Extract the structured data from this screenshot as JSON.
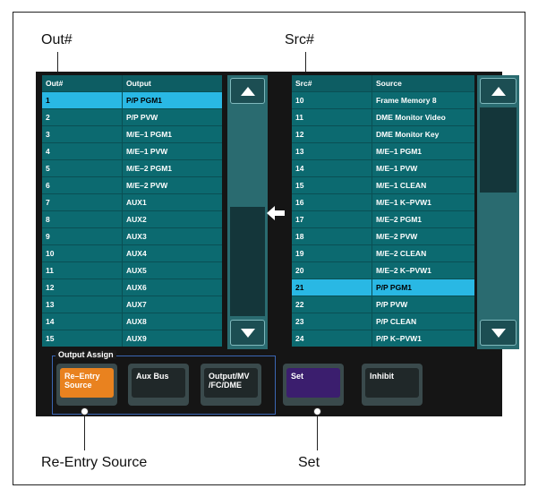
{
  "callouts": {
    "out_num": "Out#",
    "src_num": "Src#",
    "re_entry_source": "Re-Entry Source",
    "set": "Set"
  },
  "output_table": {
    "headers": [
      "Out#",
      "Output"
    ],
    "rows": [
      {
        "num": "1",
        "name": "P/P PGM1",
        "selected": true
      },
      {
        "num": "2",
        "name": "P/P PVW"
      },
      {
        "num": "3",
        "name": "M/E–1 PGM1"
      },
      {
        "num": "4",
        "name": "M/E–1 PVW"
      },
      {
        "num": "5",
        "name": "M/E–2 PGM1"
      },
      {
        "num": "6",
        "name": "M/E–2 PVW"
      },
      {
        "num": "7",
        "name": "AUX1"
      },
      {
        "num": "8",
        "name": "AUX2"
      },
      {
        "num": "9",
        "name": "AUX3"
      },
      {
        "num": "10",
        "name": "AUX4"
      },
      {
        "num": "11",
        "name": "AUX5"
      },
      {
        "num": "12",
        "name": "AUX6"
      },
      {
        "num": "13",
        "name": "AUX7"
      },
      {
        "num": "14",
        "name": "AUX8"
      },
      {
        "num": "15",
        "name": "AUX9"
      }
    ]
  },
  "source_table": {
    "headers": [
      "Src#",
      "Source"
    ],
    "rows": [
      {
        "num": "10",
        "name": "Frame Memory 8"
      },
      {
        "num": "11",
        "name": "DME Monitor Video"
      },
      {
        "num": "12",
        "name": "DME Monitor Key"
      },
      {
        "num": "13",
        "name": "M/E–1 PGM1"
      },
      {
        "num": "14",
        "name": "M/E–1 PVW"
      },
      {
        "num": "15",
        "name": "M/E–1 CLEAN"
      },
      {
        "num": "16",
        "name": "M/E–1 K–PVW1"
      },
      {
        "num": "17",
        "name": "M/E–2 PGM1"
      },
      {
        "num": "18",
        "name": "M/E–2 PVW"
      },
      {
        "num": "19",
        "name": "M/E–2 CLEAN"
      },
      {
        "num": "20",
        "name": "M/E–2 K–PVW1"
      },
      {
        "num": "21",
        "name": "P/P PGM1",
        "selected": true
      },
      {
        "num": "22",
        "name": "P/P PVW"
      },
      {
        "num": "23",
        "name": "P/P CLEAN"
      },
      {
        "num": "24",
        "name": "P/P K–PVW1"
      }
    ]
  },
  "icons": {
    "scroll_up": "triangle-up-icon",
    "scroll_down": "triangle-down-icon",
    "assign_arrow": "arrow-left-icon"
  },
  "output_assign": {
    "label": "Output Assign",
    "buttons": [
      {
        "label": "Re–Entry\nSource",
        "color": "#e9821f"
      },
      {
        "label": "Aux Bus",
        "color": "#202829"
      },
      {
        "label": "Output/MV\n/FC/DME",
        "color": "#202829"
      }
    ]
  },
  "actions": {
    "set_label": "Set",
    "set_color": "#3b1e6e",
    "inhibit_label": "Inhibit"
  },
  "colors": {
    "row_selected": "#29b8e4",
    "row_normal": "#0c6a70",
    "header": "#0d5d63"
  }
}
